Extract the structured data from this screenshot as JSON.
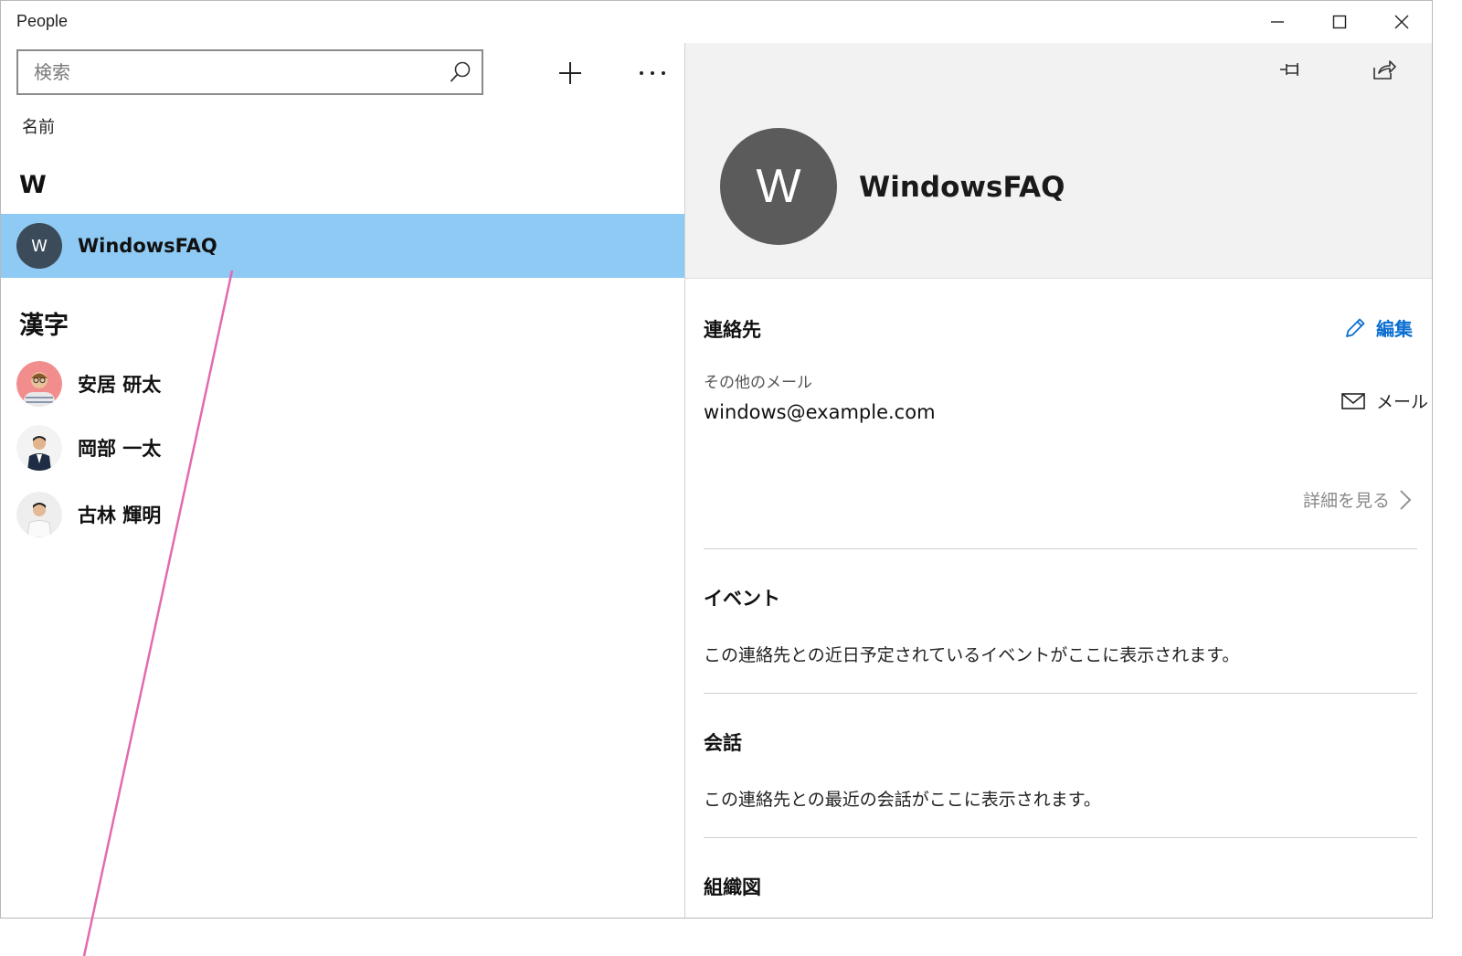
{
  "window": {
    "title": "People"
  },
  "search": {
    "placeholder": "検索",
    "value": ""
  },
  "list": {
    "sort_label": "名前",
    "groups": [
      {
        "header": "W",
        "contacts": [
          {
            "initial": "W",
            "name": "WindowsFAQ",
            "selected": true
          }
        ]
      },
      {
        "header": "漢字",
        "contacts": [
          {
            "name": "安居 研太"
          },
          {
            "name": "岡部 一太"
          },
          {
            "name": "古林 輝明"
          }
        ]
      }
    ]
  },
  "detail": {
    "avatar_initial": "W",
    "name": "WindowsFAQ",
    "contact_section": {
      "title": "連絡先",
      "edit_label": "編集",
      "field_label": "その他のメール",
      "field_value": "windows@example.com",
      "mail_label": "メール",
      "details_label": "詳細を見る"
    },
    "events_section": {
      "title": "イベント",
      "body": "この連絡先との近日予定されているイベントがここに表示されます。"
    },
    "conversations_section": {
      "title": "会話",
      "body": "この連絡先との最近の会話がここに表示されます。"
    },
    "org_section": {
      "title": "組織図"
    }
  },
  "colors": {
    "selection": "#8ecaf4",
    "accent": "#0a6ed1",
    "annotation": "#e36aae"
  }
}
